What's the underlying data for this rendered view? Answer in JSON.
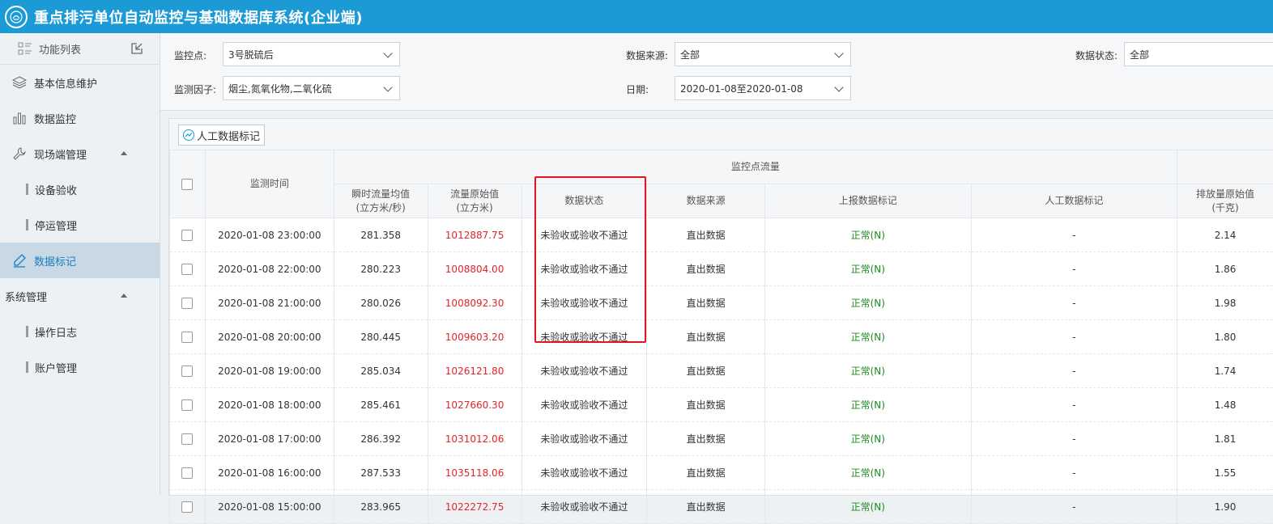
{
  "header": {
    "title": "重点排污单位自动监控与基础数据库系统(企业端)"
  },
  "sidebar": {
    "func_list_label": "功能列表",
    "items": [
      {
        "label": "基本信息维护",
        "icon": "layers-icon"
      },
      {
        "label": "数据监控",
        "icon": "bar-chart-icon"
      },
      {
        "label": "现场端管理",
        "icon": "wrench-icon"
      },
      {
        "label": "设备验收"
      },
      {
        "label": "停运管理"
      },
      {
        "label": "数据标记",
        "icon": "pen-icon"
      },
      {
        "label": "系统管理"
      },
      {
        "label": "操作日志"
      },
      {
        "label": "账户管理"
      }
    ]
  },
  "filters": {
    "monitor_point_label": "监控点:",
    "monitor_point_value": "3号脱硫后",
    "data_source_label": "数据来源:",
    "data_source_value": "全部",
    "data_status_label": "数据状态:",
    "data_status_value": "全部",
    "factor_label": "监测因子:",
    "factor_value": "烟尘,氮氧化物,二氧化硫",
    "date_label": "日期:",
    "date_value": "2020-01-08至2020-01-08"
  },
  "toolbar": {
    "manual_mark_button": "人工数据标记"
  },
  "table": {
    "group_header": "监控点流量",
    "headers": {
      "time": "监测时间",
      "inst_flow": "瞬时流量均值",
      "inst_flow_unit": "(立方米/秒)",
      "raw_flow": "流量原始值",
      "raw_flow_unit": "(立方米)",
      "status": "数据状态",
      "source": "数据来源",
      "report_mark": "上报数据标记",
      "manual_mark": "人工数据标记",
      "emission_raw": "排放量原始值",
      "emission_unit": "(千克)"
    },
    "rows": [
      [
        "2020-01-08 23:00:00",
        "281.358",
        "1012887.75",
        "未验收或验收不通过",
        "直出数据",
        "正常(N)",
        "-",
        "2.14"
      ],
      [
        "2020-01-08 22:00:00",
        "280.223",
        "1008804.00",
        "未验收或验收不通过",
        "直出数据",
        "正常(N)",
        "-",
        "1.86"
      ],
      [
        "2020-01-08 21:00:00",
        "280.026",
        "1008092.30",
        "未验收或验收不通过",
        "直出数据",
        "正常(N)",
        "-",
        "1.98"
      ],
      [
        "2020-01-08 20:00:00",
        "280.445",
        "1009603.20",
        "未验收或验收不通过",
        "直出数据",
        "正常(N)",
        "-",
        "1.80"
      ],
      [
        "2020-01-08 19:00:00",
        "285.034",
        "1026121.80",
        "未验收或验收不通过",
        "直出数据",
        "正常(N)",
        "-",
        "1.74"
      ],
      [
        "2020-01-08 18:00:00",
        "285.461",
        "1027660.30",
        "未验收或验收不通过",
        "直出数据",
        "正常(N)",
        "-",
        "1.48"
      ],
      [
        "2020-01-08 17:00:00",
        "286.392",
        "1031012.06",
        "未验收或验收不通过",
        "直出数据",
        "正常(N)",
        "-",
        "1.81"
      ],
      [
        "2020-01-08 16:00:00",
        "287.533",
        "1035118.06",
        "未验收或验收不通过",
        "直出数据",
        "正常(N)",
        "-",
        "1.55"
      ],
      [
        "2020-01-08 15:00:00",
        "283.965",
        "1022272.75",
        "未验收或验收不通过",
        "直出数据",
        "正常(N)",
        "-",
        "1.90"
      ]
    ]
  },
  "colors": {
    "header_bg": "#1c9ad6",
    "raw_flow_text": "#e0252b",
    "normal_mark_text": "#1d8a1d",
    "highlight_border": "#e3141b"
  }
}
